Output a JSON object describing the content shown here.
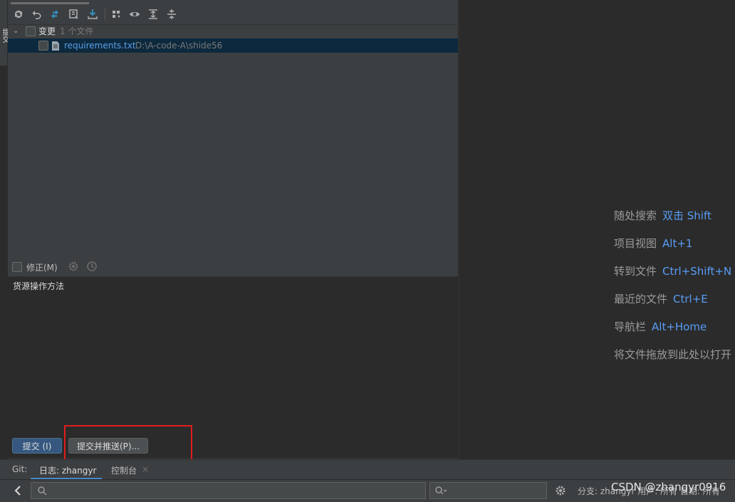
{
  "left_strip": {
    "tab": "提交"
  },
  "toolbar": {
    "buttons": [
      "refresh-icon",
      "rollback-icon",
      "diff-icon",
      "shelve-icon",
      "update-icon",
      "group-icon",
      "eye-icon",
      "expand-all-icon",
      "collapse-all-icon"
    ]
  },
  "tree": {
    "group_label": "变更",
    "group_count": "1 个文件",
    "file_name": "requirements.txt",
    "file_path": "D:\\A-code-A\\shide56"
  },
  "amend": {
    "label": "修正(M)"
  },
  "message": {
    "text": "货源操作方法"
  },
  "buttons": {
    "commit": "提交 (I)",
    "commit_push": "提交并推送(P)..."
  },
  "editor_hints": [
    {
      "label": "随处搜索",
      "key": "双击 Shift"
    },
    {
      "label": "项目视图",
      "key": "Alt+1"
    },
    {
      "label": "转到文件",
      "key": "Ctrl+Shift+N"
    },
    {
      "label": "最近的文件",
      "key": "Ctrl+E"
    },
    {
      "label": "导航栏",
      "key": "Alt+Home"
    },
    {
      "label": "将文件拖放到此处以打开",
      "key": ""
    }
  ],
  "bottom_tabs": {
    "git": "Git:",
    "log": "日志: zhangyr",
    "console": "控制台"
  },
  "status": {
    "text": "分支: zhangyr  用户: 所有  日期: 所有"
  },
  "watermark": "CSDN @zhangyr0916",
  "colors": {
    "accent": "#589df6",
    "highlight": "#e11d1d",
    "commit_button": "#365880"
  }
}
